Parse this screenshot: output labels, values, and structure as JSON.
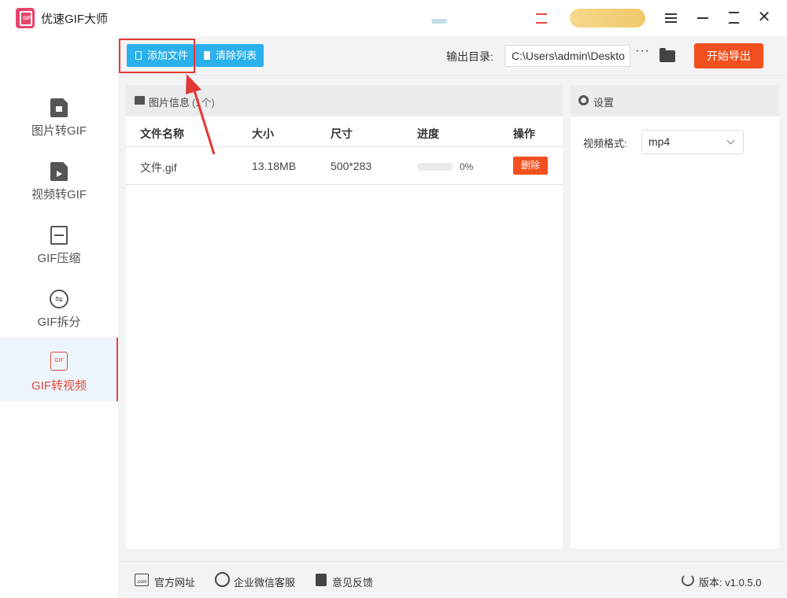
{
  "app": {
    "title": "优速GIF大师",
    "logo_text": "GIF"
  },
  "sidebar": {
    "items": [
      {
        "label": "图片转GIF",
        "icon": "image-doc-icon"
      },
      {
        "label": "视频转GIF",
        "icon": "video-doc-icon"
      },
      {
        "label": "GIF压缩",
        "icon": "compress-icon"
      },
      {
        "label": "GIF拆分",
        "icon": "split-icon"
      },
      {
        "label": "GIF转视频",
        "icon": "gif-file-icon",
        "active": true
      }
    ]
  },
  "toolbar": {
    "add_label": "添加文件",
    "clear_label": "清除列表",
    "output_label": "输出目录:",
    "output_path": "C:\\Users\\admin\\Deskto",
    "more_label": "···",
    "export_label": "开始导出"
  },
  "file_panel": {
    "title": "图片信息",
    "count": "(1个)",
    "columns": [
      "文件名称",
      "大小",
      "尺寸",
      "进度",
      "操作"
    ],
    "rows": [
      {
        "name": "文件.gif",
        "size": "13.18MB",
        "dims": "500*283",
        "progress": 0,
        "progress_text": "0%",
        "action": "删除"
      }
    ]
  },
  "settings": {
    "title": "设置",
    "format_label": "视频格式:",
    "format_value": "mp4"
  },
  "footer": {
    "website": "官方网址",
    "wechat": "企业微信客服",
    "feedback": "意见反馈",
    "version": "版本: v1.0.5.0"
  },
  "colors": {
    "accent_blue": "#2ab0ec",
    "accent_orange": "#f2501e",
    "active_red": "#e04b3a"
  }
}
